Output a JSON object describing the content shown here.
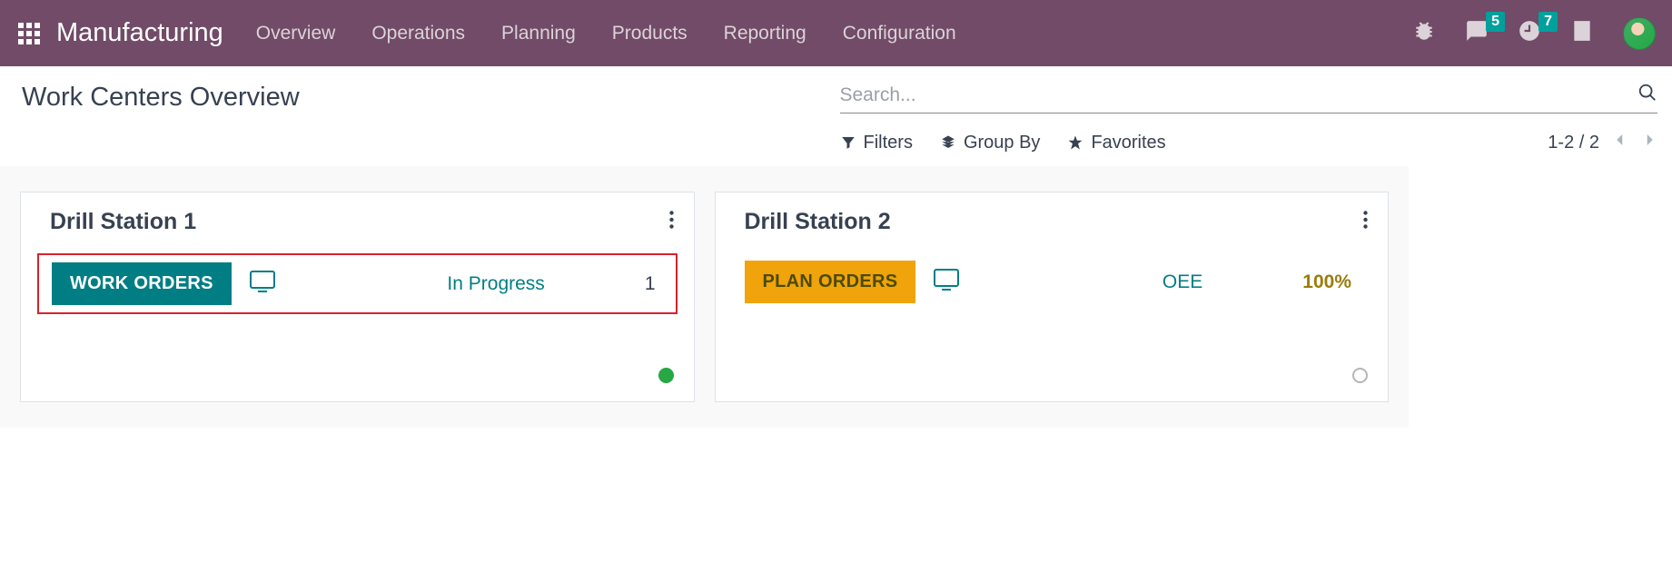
{
  "nav": {
    "brand": "Manufacturing",
    "items": [
      "Overview",
      "Operations",
      "Planning",
      "Products",
      "Reporting",
      "Configuration"
    ],
    "msg_badge": "5",
    "clock_badge": "7"
  },
  "page": {
    "title": "Work Centers Overview",
    "search_placeholder": "Search...",
    "filters": "Filters",
    "group_by": "Group By",
    "favorites": "Favorites",
    "pager": "1-2 / 2"
  },
  "cards": [
    {
      "title": "Drill Station 1",
      "button": "WORK ORDERS",
      "button_style": "teal",
      "monitor_color": "#017E84",
      "stat_label": "In Progress",
      "stat_value": "1",
      "stat_value_style": "dark",
      "status": "green",
      "highlighted": true
    },
    {
      "title": "Drill Station 2",
      "button": "PLAN ORDERS",
      "button_style": "amber",
      "monitor_color": "#017E84",
      "stat_label": "OEE",
      "stat_value": "100%",
      "stat_value_style": "gold",
      "status": "hollow",
      "highlighted": false
    }
  ]
}
